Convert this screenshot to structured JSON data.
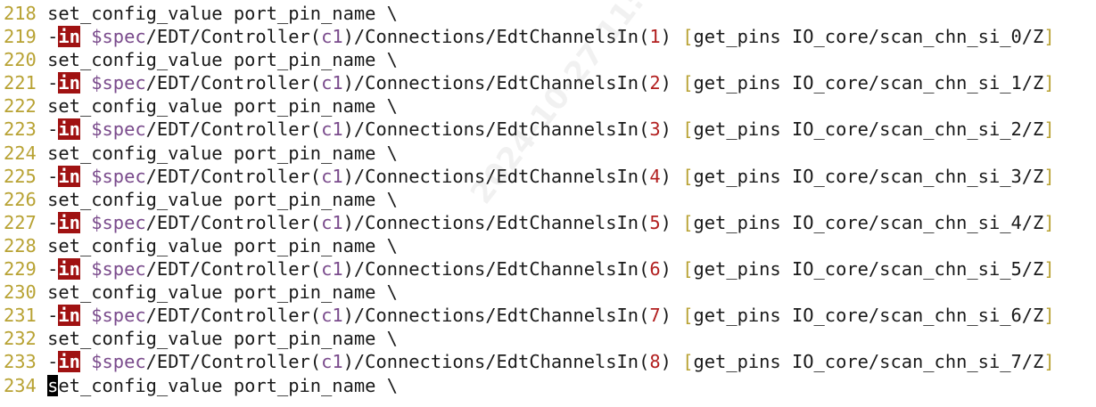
{
  "editor": {
    "lines": [
      {
        "num": "218",
        "text": "set_config_value port_pin_name \\"
      },
      {
        "num": "219",
        "flag": "in",
        "path_prefix": "$spec",
        "path_mid": "/EDT/Controller(",
        "ctrl": "c1",
        "path_tail": ")/Connections/EdtChannelsIn(",
        "index": "1",
        "close": ")",
        "pins_cmd": "get_pins IO_core/scan_chn_si_0/Z"
      },
      {
        "num": "220",
        "text": "set_config_value port_pin_name \\"
      },
      {
        "num": "221",
        "flag": "in",
        "path_prefix": "$spec",
        "path_mid": "/EDT/Controller(",
        "ctrl": "c1",
        "path_tail": ")/Connections/EdtChannelsIn(",
        "index": "2",
        "close": ")",
        "pins_cmd": "get_pins IO_core/scan_chn_si_1/Z"
      },
      {
        "num": "222",
        "text": "set_config_value port_pin_name \\"
      },
      {
        "num": "223",
        "flag": "in",
        "path_prefix": "$spec",
        "path_mid": "/EDT/Controller(",
        "ctrl": "c1",
        "path_tail": ")/Connections/EdtChannelsIn(",
        "index": "3",
        "close": ")",
        "pins_cmd": "get_pins IO_core/scan_chn_si_2/Z"
      },
      {
        "num": "224",
        "text": "set_config_value port_pin_name \\"
      },
      {
        "num": "225",
        "flag": "in",
        "path_prefix": "$spec",
        "path_mid": "/EDT/Controller(",
        "ctrl": "c1",
        "path_tail": ")/Connections/EdtChannelsIn(",
        "index": "4",
        "close": ")",
        "pins_cmd": "get_pins IO_core/scan_chn_si_3/Z"
      },
      {
        "num": "226",
        "text": "set_config_value port_pin_name \\"
      },
      {
        "num": "227",
        "flag": "in",
        "path_prefix": "$spec",
        "path_mid": "/EDT/Controller(",
        "ctrl": "c1",
        "path_tail": ")/Connections/EdtChannelsIn(",
        "index": "5",
        "close": ")",
        "pins_cmd": "get_pins IO_core/scan_chn_si_4/Z"
      },
      {
        "num": "228",
        "text": "set_config_value port_pin_name \\"
      },
      {
        "num": "229",
        "flag": "in",
        "path_prefix": "$spec",
        "path_mid": "/EDT/Controller(",
        "ctrl": "c1",
        "path_tail": ")/Connections/EdtChannelsIn(",
        "index": "6",
        "close": ")",
        "pins_cmd": "get_pins IO_core/scan_chn_si_5/Z"
      },
      {
        "num": "230",
        "text": "set_config_value port_pin_name \\"
      },
      {
        "num": "231",
        "flag": "in",
        "path_prefix": "$spec",
        "path_mid": "/EDT/Controller(",
        "ctrl": "c1",
        "path_tail": ")/Connections/EdtChannelsIn(",
        "index": "7",
        "close": ")",
        "pins_cmd": "get_pins IO_core/scan_chn_si_6/Z"
      },
      {
        "num": "232",
        "text": "set_config_value port_pin_name \\"
      },
      {
        "num": "233",
        "flag": "in",
        "path_prefix": "$spec",
        "path_mid": "/EDT/Controller(",
        "ctrl": "c1",
        "path_tail": ")/Connections/EdtChannelsIn(",
        "index": "8",
        "close": ")",
        "pins_cmd": "get_pins IO_core/scan_chn_si_7/Z"
      },
      {
        "num": "234",
        "cursor_char": "s",
        "text": "et_config_value port_pin_name \\"
      }
    ]
  },
  "watermark": {
    "text": "2024-10-27 11:00:02 00-45-E2-FF-8A-4F"
  },
  "colors": {
    "line_number": "#b8a233",
    "flag_background": "#a01212",
    "variable": "#7a4b8c",
    "number": "#b21f1f",
    "bracket": "#b8a233",
    "text": "#1a1a1a"
  }
}
